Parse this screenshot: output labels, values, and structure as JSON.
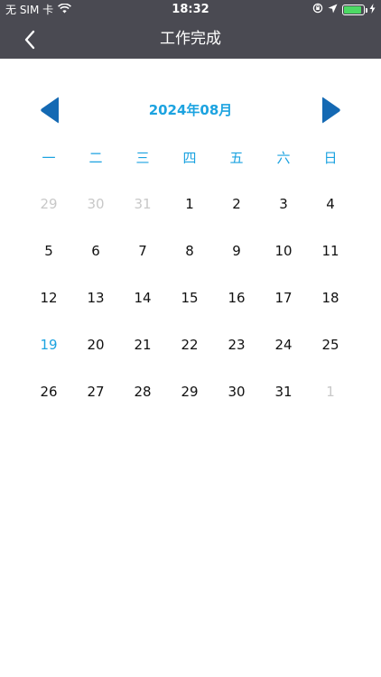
{
  "status_bar": {
    "carrier": "无 SIM 卡",
    "time": "18:32",
    "battery_level": 0.9,
    "battery_color": "#4cd964"
  },
  "nav": {
    "title": "工作完成",
    "back_icon": "chevron-left-icon"
  },
  "calendar": {
    "month_title": "2024年08月",
    "prev_icon": "triangle-left-icon",
    "next_icon": "triangle-right-icon",
    "accent_color": "#1ca3e0",
    "weekdays": [
      "一",
      "二",
      "三",
      "四",
      "五",
      "六",
      "日"
    ],
    "weeks": [
      [
        {
          "day": "29",
          "state": "muted"
        },
        {
          "day": "30",
          "state": "muted"
        },
        {
          "day": "31",
          "state": "muted"
        },
        {
          "day": "1",
          "state": "normal"
        },
        {
          "day": "2",
          "state": "normal"
        },
        {
          "day": "3",
          "state": "normal"
        },
        {
          "day": "4",
          "state": "normal"
        }
      ],
      [
        {
          "day": "5",
          "state": "normal"
        },
        {
          "day": "6",
          "state": "normal"
        },
        {
          "day": "7",
          "state": "normal"
        },
        {
          "day": "8",
          "state": "normal"
        },
        {
          "day": "9",
          "state": "normal"
        },
        {
          "day": "10",
          "state": "normal"
        },
        {
          "day": "11",
          "state": "normal"
        }
      ],
      [
        {
          "day": "12",
          "state": "normal"
        },
        {
          "day": "13",
          "state": "normal"
        },
        {
          "day": "14",
          "state": "normal"
        },
        {
          "day": "15",
          "state": "normal"
        },
        {
          "day": "16",
          "state": "normal"
        },
        {
          "day": "17",
          "state": "normal"
        },
        {
          "day": "18",
          "state": "normal"
        }
      ],
      [
        {
          "day": "19",
          "state": "today"
        },
        {
          "day": "20",
          "state": "normal"
        },
        {
          "day": "21",
          "state": "normal"
        },
        {
          "day": "22",
          "state": "normal"
        },
        {
          "day": "23",
          "state": "normal"
        },
        {
          "day": "24",
          "state": "normal"
        },
        {
          "day": "25",
          "state": "normal"
        }
      ],
      [
        {
          "day": "26",
          "state": "normal"
        },
        {
          "day": "27",
          "state": "normal"
        },
        {
          "day": "28",
          "state": "normal"
        },
        {
          "day": "29",
          "state": "normal"
        },
        {
          "day": "30",
          "state": "normal"
        },
        {
          "day": "31",
          "state": "normal"
        },
        {
          "day": "1",
          "state": "muted"
        }
      ]
    ]
  }
}
